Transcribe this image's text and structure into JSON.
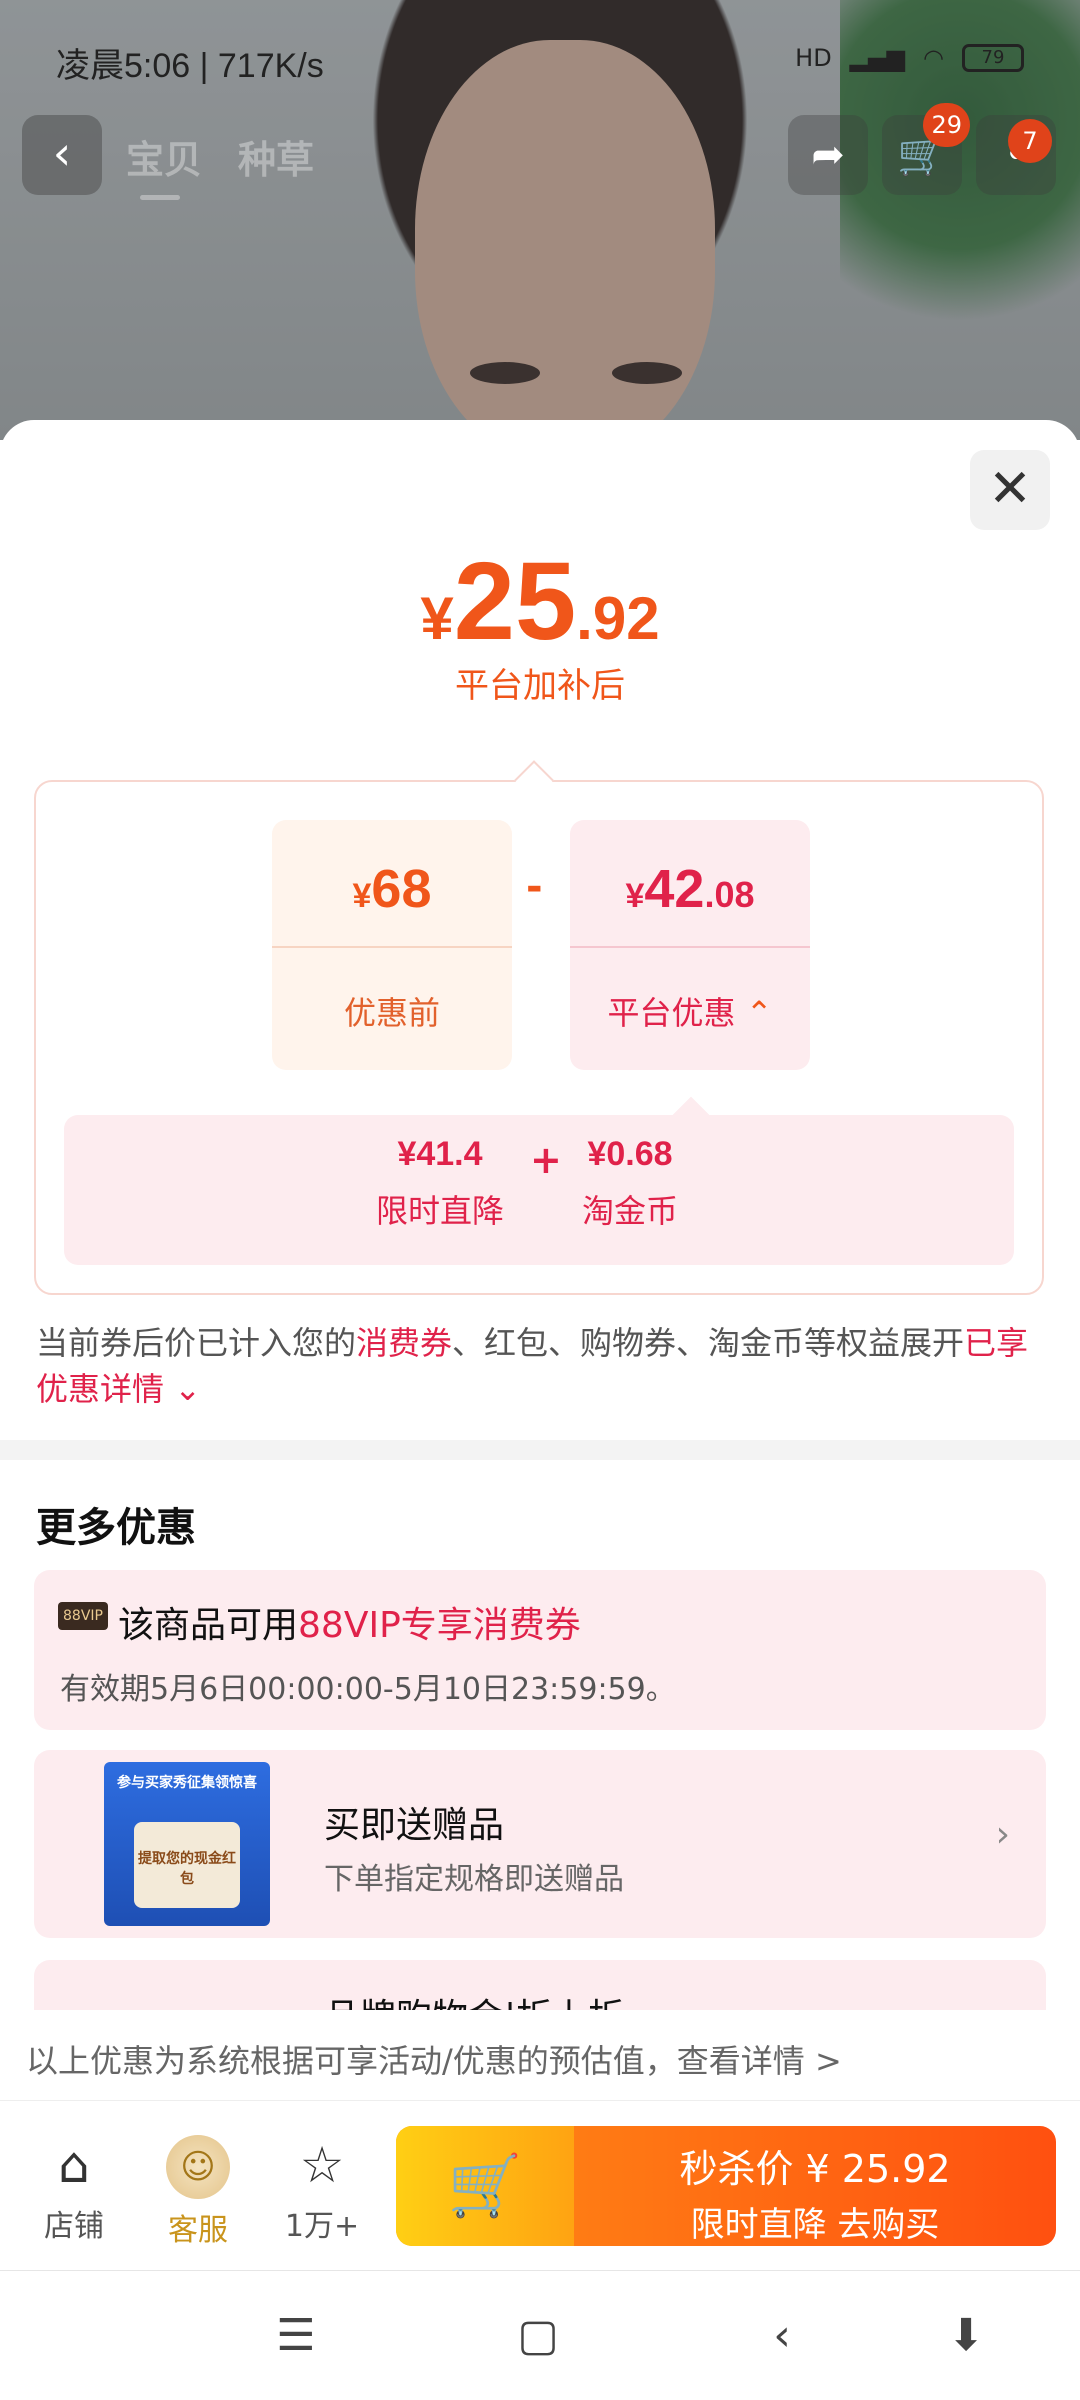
{
  "status": {
    "time": "凌晨5:06 | 717K/s",
    "network": "HD",
    "battery": "79"
  },
  "topnav": {
    "tabs": [
      "宝贝",
      "种草"
    ],
    "cart_badge": "29",
    "more_badge": "7"
  },
  "price": {
    "currency": "¥",
    "integer": "25",
    "decimal": ".92",
    "subtitle": "平台加补后"
  },
  "breakdown": {
    "before": {
      "currency": "¥",
      "integer": "68",
      "decimal": "",
      "label": "优惠前"
    },
    "minus": "-",
    "platform": {
      "currency": "¥",
      "integer": "42",
      "decimal": ".08",
      "label": "平台优惠"
    },
    "plus": "+",
    "items": [
      {
        "value": "¥41.4",
        "label": "限时直降"
      },
      {
        "value": "¥0.68",
        "label": "淘金币"
      }
    ]
  },
  "note": {
    "prefix": "当前券后价已计入您的",
    "highlight1": "消费券",
    "middle": "、红包、购物券、淘金币等权益展开",
    "highlight2": "已享优惠详情"
  },
  "more": {
    "title": "更多优惠",
    "promos": [
      {
        "tag": "88VIP",
        "title_prefix": "该商品可用",
        "title_highlight": "88VIP专享消费券",
        "subtitle": "有效期5月6日00:00:00-5月10日23:59:59。"
      },
      {
        "image_title": "参与买家秀征集领惊喜",
        "image_text": "提取您的现金红包",
        "title": "买即送赠品",
        "subtitle": "下单指定规格即送赠品"
      },
      {
        "title": "品牌购物金|折上折"
      }
    ]
  },
  "footnote": "以上优惠为系统根据可享活动/优惠的预估值，查看详情 >",
  "actions": {
    "shop": "店铺",
    "service": "客服",
    "favorite": "1万+",
    "buy_line1": "秒杀价 ¥ 25.92",
    "buy_line2": "限时直降  去购买"
  },
  "colors": {
    "accent_orange": "#f0561a",
    "accent_red": "#e0224a",
    "service_gold": "#c9941c"
  }
}
